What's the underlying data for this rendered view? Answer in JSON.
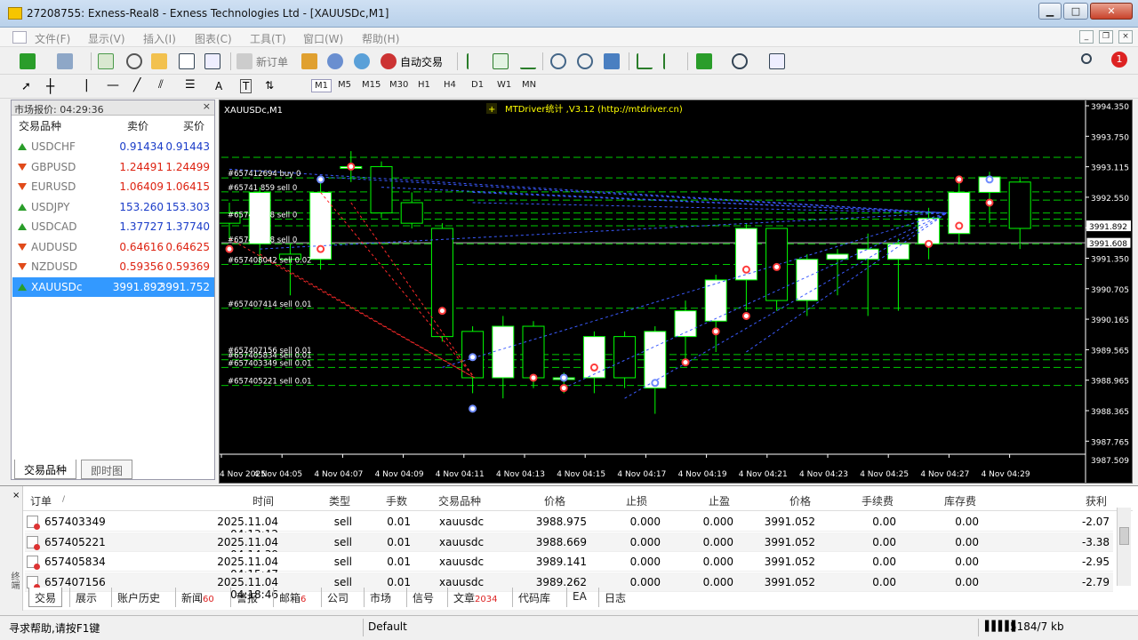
{
  "window": {
    "title": "27208755: Exness-Real8 - Exness Technologies Ltd - [XAUUSDc,M1]"
  },
  "menu": [
    "文件(F)",
    "显示(V)",
    "插入(I)",
    "图表(C)",
    "工具(T)",
    "窗口(W)",
    "帮助(H)"
  ],
  "toolbar": {
    "new_order": "新订单",
    "auto_trade": "自动交易",
    "alert_count": "1"
  },
  "timeframes": [
    "M1",
    "M5",
    "M15",
    "M30",
    "H1",
    "H4",
    "D1",
    "W1",
    "MN"
  ],
  "market_watch": {
    "header": "市场报价: 04:29:36",
    "col_symbol": "交易品种",
    "col_bid": "卖价",
    "col_ask": "买价",
    "rows": [
      {
        "symbol": "USDCHF",
        "bid": "0.91434",
        "ask": "0.91443",
        "dir": "up"
      },
      {
        "symbol": "GBPUSD",
        "bid": "1.24491",
        "ask": "1.24499",
        "dir": "down"
      },
      {
        "symbol": "EURUSD",
        "bid": "1.06409",
        "ask": "1.06415",
        "dir": "down"
      },
      {
        "symbol": "USDJPY",
        "bid": "153.260",
        "ask": "153.303",
        "dir": "up"
      },
      {
        "symbol": "USDCAD",
        "bid": "1.37727",
        "ask": "1.37740",
        "dir": "up"
      },
      {
        "symbol": "AUDUSD",
        "bid": "0.64616",
        "ask": "0.64625",
        "dir": "down"
      },
      {
        "symbol": "NZDUSD",
        "bid": "0.59356",
        "ask": "0.59369",
        "dir": "down"
      },
      {
        "symbol": "XAUUSDc",
        "bid": "3991.892",
        "ask": "3991.752",
        "dir": "up"
      }
    ],
    "tabs": [
      "交易品种",
      "即时图"
    ]
  },
  "chart": {
    "symbol_label": "XAUUSDc,M1",
    "indicator_label": "MTDriver统计 ,V3.12 (http://mtdriver.cn)",
    "price_ticks": [
      "3994.350",
      "3993.750",
      "3993.115",
      "3992.550",
      "3991.950",
      "3991.350",
      "3990.705",
      "3990.165",
      "3989.565",
      "3988.965",
      "3988.365",
      "3987.765"
    ],
    "current_bid": "3991.892",
    "current_ask": "3991.608",
    "bottom_tick": "3987.509",
    "time_ticks": [
      "4 Nov 2025",
      "4 Nov 04:05",
      "4 Nov 04:07",
      "4 Nov 04:09",
      "4 Nov 04:11",
      "4 Nov 04:13",
      "4 Nov 04:15",
      "4 Nov 04:17",
      "4 Nov 04:19",
      "4 Nov 04:21",
      "4 Nov 04:23",
      "4 Nov 04:25",
      "4 Nov 04:27",
      "4 Nov 04:29"
    ],
    "order_labels": [
      {
        "text": "#657412694 buy 0",
        "price": 3992.88
      },
      {
        "text": "#65741 859 sell 0",
        "price": 3992.61
      },
      {
        "text": "#65741 978 sell 0",
        "price": 3992.08
      },
      {
        "text": "#65741 888 sell 0",
        "price": 3991.6
      },
      {
        "text": "#657408042 sell 0.02",
        "price": 3991.2
      },
      {
        "text": "#657407414 sell 0.01",
        "price": 3990.35
      },
      {
        "text": "#657407156 sell 0.01",
        "price": 3989.45
      },
      {
        "text": "#657405834 sell 0.01",
        "price": 3989.35
      },
      {
        "text": "#657403349 sell 0.01",
        "price": 3989.2
      },
      {
        "text": "#657405221 sell 0.01",
        "price": 3988.85
      }
    ],
    "candles": [
      [
        3992.2,
        3992.0,
        3992.4,
        3991.7
      ],
      [
        3991.6,
        3992.6,
        3992.7,
        3991.2
      ],
      [
        3991.4,
        3991.3,
        3991.6,
        3990.6
      ],
      [
        3991.3,
        3992.6,
        3992.8,
        3991.1
      ],
      [
        3993.1,
        3993.1,
        3993.4,
        3992.8
      ],
      [
        3993.1,
        3992.2,
        3993.2,
        3992.1
      ],
      [
        3992.4,
        3992.0,
        3992.6,
        3991.9
      ],
      [
        3991.9,
        3989.8,
        3992.0,
        3989.7
      ],
      [
        3989.9,
        3989.0,
        3990.0,
        3988.7
      ],
      [
        3989.0,
        3990.0,
        3990.2,
        3988.6
      ],
      [
        3990.0,
        3989.0,
        3990.1,
        3988.8
      ],
      [
        3989.0,
        3989.0,
        3989.1,
        3988.7
      ],
      [
        3989.0,
        3989.8,
        3989.9,
        3988.7
      ],
      [
        3989.8,
        3989.0,
        3989.9,
        3988.8
      ],
      [
        3988.8,
        3989.9,
        3990.0,
        3988.3
      ],
      [
        3989.8,
        3990.3,
        3990.5,
        3989.3
      ],
      [
        3990.1,
        3990.9,
        3991.0,
        3989.5
      ],
      [
        3990.9,
        3991.9,
        3992.0,
        3990.3
      ],
      [
        3991.9,
        3990.5,
        3991.9,
        3990.3
      ],
      [
        3990.5,
        3991.3,
        3991.4,
        3990.2
      ],
      [
        3991.3,
        3991.4,
        3991.5,
        3990.6
      ],
      [
        3991.3,
        3991.5,
        3991.8,
        3990.2
      ],
      [
        3991.3,
        3991.6,
        3991.7,
        3990.3
      ],
      [
        3991.6,
        3992.1,
        3992.3,
        3991.3
      ],
      [
        3991.8,
        3992.6,
        3992.8,
        3991.6
      ],
      [
        3992.6,
        3992.9,
        3993.0,
        3992.0
      ],
      [
        3992.8,
        3991.9,
        3992.9,
        3991.5
      ]
    ]
  },
  "terminal": {
    "headers": [
      "订单",
      "时间",
      "类型",
      "手数",
      "交易品种",
      "价格",
      "止损",
      "止盈",
      "价格",
      "手续费",
      "库存费",
      "获利"
    ],
    "rows": [
      {
        "order": "657403349",
        "time": "2025.11.04 04:13:12",
        "type": "sell",
        "lots": "0.01",
        "symbol": "xauusdc",
        "price": "3988.975",
        "sl": "0.000",
        "tp": "0.000",
        "cur": "3991.052",
        "comm": "0.00",
        "swap": "0.00",
        "profit": "-2.07"
      },
      {
        "order": "657405221",
        "time": "2025.11.04 04:14:39",
        "type": "sell",
        "lots": "0.01",
        "symbol": "xauusdc",
        "price": "3988.669",
        "sl": "0.000",
        "tp": "0.000",
        "cur": "3991.052",
        "comm": "0.00",
        "swap": "0.00",
        "profit": "-3.38"
      },
      {
        "order": "657405834",
        "time": "2025.11.04 04:15:47",
        "type": "sell",
        "lots": "0.01",
        "symbol": "xauusdc",
        "price": "3989.141",
        "sl": "0.000",
        "tp": "0.000",
        "cur": "3991.052",
        "comm": "0.00",
        "swap": "0.00",
        "profit": "-2.95"
      },
      {
        "order": "657407156",
        "time": "2025.11.04 04:18:46",
        "type": "sell",
        "lots": "0.01",
        "symbol": "xauusdc",
        "price": "3989.262",
        "sl": "0.000",
        "tp": "0.000",
        "cur": "3991.052",
        "comm": "0.00",
        "swap": "0.00",
        "profit": "-2.79"
      }
    ],
    "tabs": [
      {
        "label": "交易",
        "badge": ""
      },
      {
        "label": "展示",
        "badge": ""
      },
      {
        "label": "账户历史",
        "badge": ""
      },
      {
        "label": "新闻",
        "badge": "60"
      },
      {
        "label": "警报",
        "badge": ""
      },
      {
        "label": "邮箱",
        "badge": "6"
      },
      {
        "label": "公司",
        "badge": ""
      },
      {
        "label": "市场",
        "badge": ""
      },
      {
        "label": "信号",
        "badge": ""
      },
      {
        "label": "文章",
        "badge": "2034"
      },
      {
        "label": "代码库",
        "badge": ""
      },
      {
        "label": "EA",
        "badge": ""
      },
      {
        "label": "日志",
        "badge": ""
      }
    ],
    "side_label": "终端"
  },
  "status": {
    "help": "寻求帮助,请按F1键",
    "profile": "Default",
    "traffic": "5184/7 kb"
  },
  "colors": {
    "bull": "#ffffff",
    "bear": "#000000",
    "candle_border": "#00ff00",
    "grid_green": "#00cc00",
    "buy_line": "#3b5bff",
    "sell_line": "#ff2a2a",
    "selected_row": "#3399ff"
  }
}
